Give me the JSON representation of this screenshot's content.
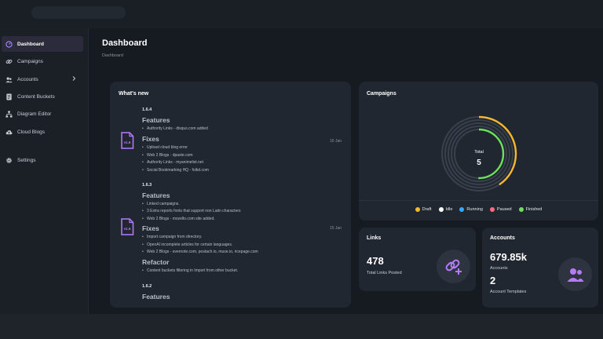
{
  "sidebar": {
    "items": [
      {
        "label": "Dashboard",
        "icon": "dashboard-gauge-icon"
      },
      {
        "label": "Campaigns",
        "icon": "link-icon"
      },
      {
        "label": "Accounts",
        "icon": "users-icon"
      },
      {
        "label": "Content Buckets",
        "icon": "document-icon"
      },
      {
        "label": "Diagram Editor",
        "icon": "diagram-icon"
      },
      {
        "label": "Cloud Blogs",
        "icon": "cloud-upload-icon"
      },
      {
        "label": "Settings",
        "icon": "gear-icon"
      }
    ]
  },
  "header": {
    "title": "Dashboard",
    "breadcrumb": "Dashboard"
  },
  "whats_new": {
    "title": "What's new",
    "releases": [
      {
        "version": "1.6.4",
        "icon_label": "v1.6",
        "date": "16 Jan",
        "features_title": "Features",
        "features": [
          "Authority Links - disqus.com added"
        ],
        "fixes_title": "Fixes",
        "fixes": [
          "Upload cloud blog error",
          "Web 2 Blogs - dpaste.com",
          "Authority Links - myanimelist.net",
          "Social Bookmarking HQ - folkd.com"
        ]
      },
      {
        "version": "1.6.3",
        "icon_label": "v1.6",
        "date": "15 Jan",
        "features_title": "Features",
        "features": [
          "Linked campaigns.",
          "3 Extra reports fonts that support non Latin characters",
          "Web 2 Blogs - mozello.com site added."
        ],
        "fixes_title": "Fixes",
        "fixes": [
          "Import campaign from directory.",
          "OpenAI incomplete articles for certain languages.",
          "Web 2 Blogs - evernote.com, postach.io, muse.io, ricepage.com"
        ],
        "refactor_title": "Refactor",
        "refactor": [
          "Content buckets filtering in Import from other bucket."
        ]
      },
      {
        "version": "1.6.2",
        "features_title": "Features"
      }
    ]
  },
  "campaigns": {
    "title": "Campaigns",
    "total_label": "Total",
    "total_value": "5",
    "legend": [
      {
        "label": "Draft",
        "color": "#f5b82e"
      },
      {
        "label": "Idle",
        "color": "#ffffff"
      },
      {
        "label": "Running",
        "color": "#3aa7ff"
      },
      {
        "label": "Paused",
        "color": "#ff6b81"
      },
      {
        "label": "Finished",
        "color": "#6be15a"
      }
    ]
  },
  "links": {
    "title": "Links",
    "value": "478",
    "label": "Total Links Posted",
    "icon": "link-add-icon"
  },
  "accounts": {
    "title": "Accounts",
    "value": "679.85k",
    "value_label": "Accounts",
    "templates_value": "2",
    "templates_label": "Account Templates",
    "icon": "users-icon"
  },
  "colors": {
    "accent": "#8b5cf6",
    "bg": "#161b22",
    "card": "#212730"
  }
}
